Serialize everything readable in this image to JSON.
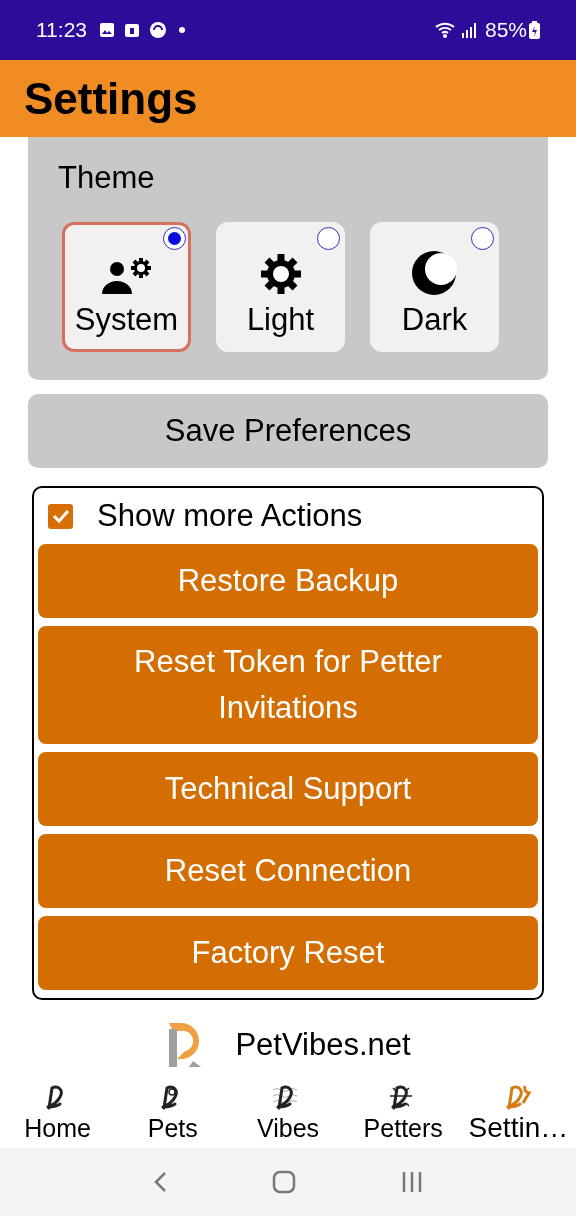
{
  "status_bar": {
    "time": "11:23",
    "battery": "85%"
  },
  "app_bar": {
    "title": "Settings"
  },
  "theme": {
    "label": "Theme",
    "options": [
      {
        "kind": "system",
        "label": "System",
        "selected": true
      },
      {
        "kind": "light",
        "label": "Light",
        "selected": false
      },
      {
        "kind": "dark",
        "label": "Dark",
        "selected": false
      }
    ]
  },
  "save_button": "Save Preferences",
  "actions": {
    "toggle": {
      "label": "Show more Actions",
      "checked": true
    },
    "buttons": [
      "Restore Backup",
      "Reset Token for Petter Invitations",
      "Technical Support",
      "Reset Connection",
      "Factory Reset"
    ]
  },
  "brand": "PetVibes.net",
  "tabs": [
    {
      "kind": "home",
      "label": "Home",
      "selected": false
    },
    {
      "kind": "pets",
      "label": "Pets",
      "selected": false
    },
    {
      "kind": "vibes",
      "label": "Vibes",
      "selected": false
    },
    {
      "kind": "petters",
      "label": "Petters",
      "selected": false
    },
    {
      "kind": "settings",
      "label": "Settin…",
      "selected": true
    }
  ]
}
